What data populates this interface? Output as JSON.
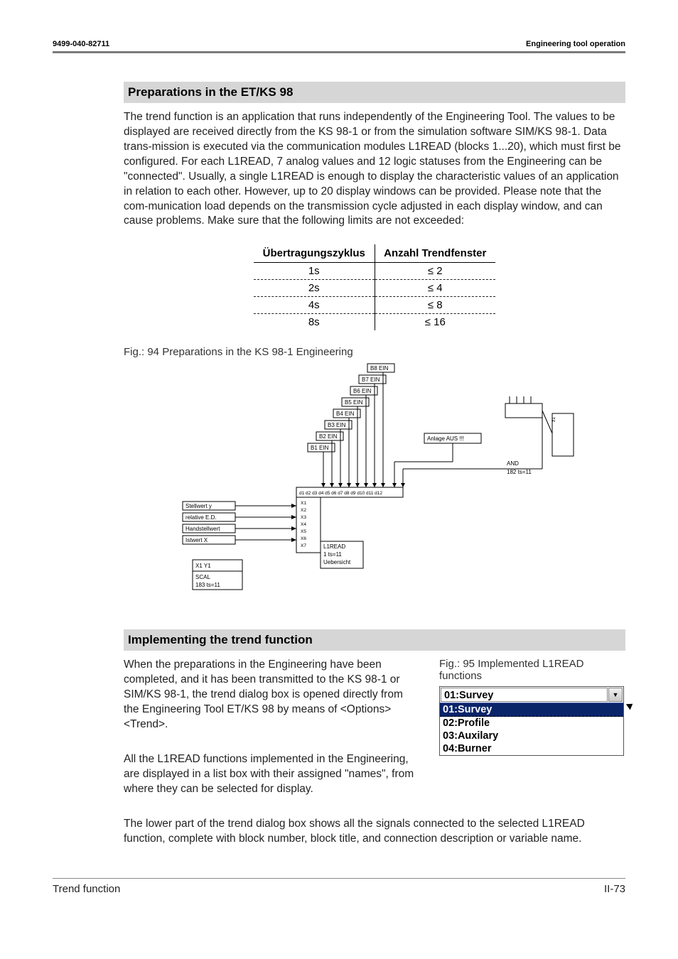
{
  "header": {
    "doc_number": "9499-040-82711",
    "section_title": "Engineering tool operation"
  },
  "sections": {
    "prep": {
      "heading": "Preparations in the ET/KS 98",
      "body": "The trend function is an application that runs independently of the Engineering Tool. The values to be displayed are received directly from the KS 98-1 or from the simulation software SIM/KS 98-1. Data trans-mission is executed via the communication modules L1READ (blocks 1...20), which must first be configured. For each L1READ, 7 analog values and 12 logic statuses from the Engineering can be \"connected\". Usually, a single L1READ is enough to display the characteristic values of an application in relation to each other. However, up to 20 display windows can be provided. Please note that the com-munication load depends on the transmission cycle adjusted in each display window, and can cause problems. Make sure that the following limits are not exceeded:"
    },
    "limits_table": {
      "headers": [
        "Übertragungszyklus",
        "Anzahl Trendfenster"
      ],
      "rows": [
        [
          "1s",
          "≤ 2"
        ],
        [
          "2s",
          "≤ 4"
        ],
        [
          "4s",
          "≤ 8"
        ],
        [
          "8s",
          "≤ 16"
        ]
      ]
    },
    "fig94": {
      "caption": "Fig.: 94 Preparations in the KS 98-1 Engineering",
      "labels": {
        "B8": "B8 EIN",
        "B7": "B7 EIN",
        "B6": "B6 EIN",
        "B5": "B5 EIN",
        "B4": "B4 EIN",
        "B3": "B3 EIN",
        "B2": "B2 EIN",
        "B1": "B1 EIN",
        "anlage": "Anlage AUS !!!",
        "and_line1": "AND",
        "and_line2": "182 ts=11",
        "stellwert": "Stellwert y",
        "relative": "relative E.D.",
        "handstell": "Handstellwert",
        "istwert": "Istwert X",
        "l1read": "L1READ",
        "ts": "1 ts=11",
        "ueber": "Uebersicht",
        "scal": "SCAL",
        "scal_ts": "183 ts=11",
        "scal_xy": "X1    Y1",
        "ports_x": [
          "X1",
          "X2",
          "X3",
          "X4",
          "X5",
          "X6",
          "X7"
        ]
      }
    },
    "impl": {
      "heading": "Implementing the trend function",
      "p1": "When the preparations in the Engineering have been completed, and it has been transmitted to the KS 98-1 or SIM/KS 98-1, the trend dialog box is opened directly from the Engineering Tool ET/KS 98 by means of <Options><Trend>.",
      "p2": "All the L1READ functions implemented in the Engineering, are displayed in a list box with their assigned \"names\", from where they can be selected for display.",
      "p3": "The lower part of the trend dialog box shows all the signals connected to the selected L1READ function, complete with block number, block title, and connection description or variable name."
    },
    "fig95": {
      "caption": "Fig.: 95  Implemented L1READ functions",
      "selected": "01:Survey",
      "highlighted": "01:Survey",
      "items": [
        "02:Profile",
        "03:Auxilary",
        "04:Burner"
      ]
    }
  },
  "footer": {
    "left": "Trend function",
    "right": "II-73"
  }
}
